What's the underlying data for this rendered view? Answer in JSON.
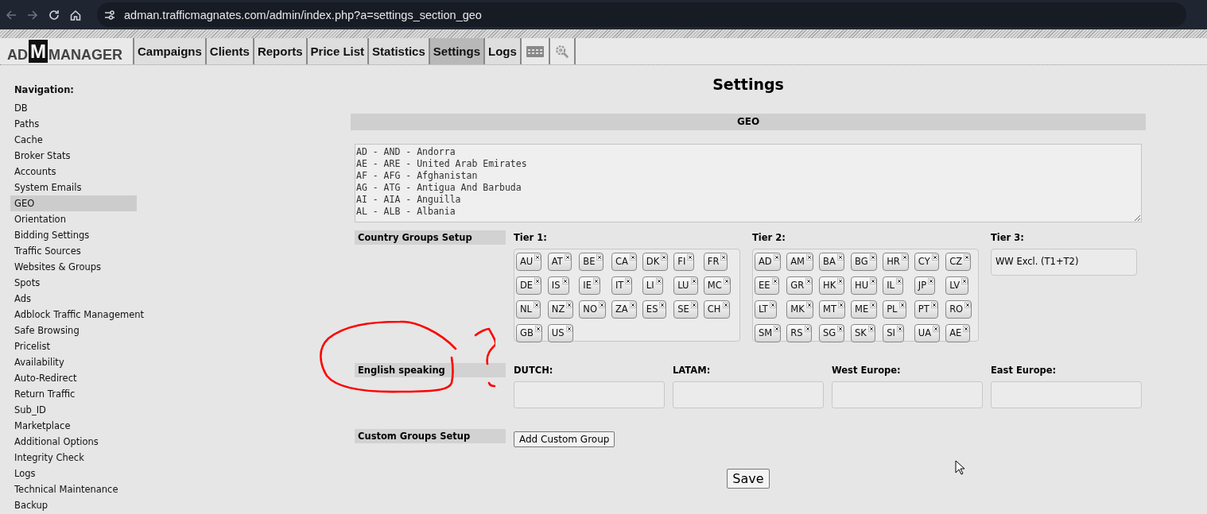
{
  "browser": {
    "url": "adman.trafficmagnates.com/admin/index.php?a=settings_section_geo"
  },
  "logo": {
    "left": "AD",
    "mark": "M",
    "right": "MANAGER"
  },
  "tabs": [
    {
      "label": "Campaigns",
      "selected": false
    },
    {
      "label": "Clients",
      "selected": false
    },
    {
      "label": "Reports",
      "selected": false
    },
    {
      "label": "Price List",
      "selected": false
    },
    {
      "label": "Statistics",
      "selected": false
    },
    {
      "label": "Settings",
      "selected": true
    },
    {
      "label": "Logs",
      "selected": false
    }
  ],
  "sidebar": {
    "heading": "Navigation:",
    "items": [
      {
        "label": "DB",
        "selected": false
      },
      {
        "label": "Paths",
        "selected": false
      },
      {
        "label": "Cache",
        "selected": false
      },
      {
        "label": "Broker Stats",
        "selected": false
      },
      {
        "label": "Accounts",
        "selected": false
      },
      {
        "label": "System Emails",
        "selected": false
      },
      {
        "label": "GEO",
        "selected": true
      },
      {
        "label": "Orientation",
        "selected": false
      },
      {
        "label": "Bidding Settings",
        "selected": false
      },
      {
        "label": "Traffic Sources",
        "selected": false
      },
      {
        "label": "Websites & Groups",
        "selected": false
      },
      {
        "label": "Spots",
        "selected": false
      },
      {
        "label": "Ads",
        "selected": false
      },
      {
        "label": "Adblock Traffic Management",
        "selected": false
      },
      {
        "label": "Safe Browsing",
        "selected": false
      },
      {
        "label": "Pricelist",
        "selected": false
      },
      {
        "label": "Availability",
        "selected": false
      },
      {
        "label": "Auto-Redirect",
        "selected": false
      },
      {
        "label": "Return Traffic",
        "selected": false
      },
      {
        "label": "Sub_ID",
        "selected": false
      },
      {
        "label": "Marketplace",
        "selected": false
      },
      {
        "label": "Additional Options",
        "selected": false
      },
      {
        "label": "Integrity Check",
        "selected": false
      },
      {
        "label": "Logs",
        "selected": false
      },
      {
        "label": "Technical Maintenance",
        "selected": false
      },
      {
        "label": "Backup",
        "selected": false
      }
    ]
  },
  "main": {
    "title": "Settings",
    "section_title": "GEO",
    "country_list": [
      "AD - AND - Andorra",
      "AE - ARE - United Arab Emirates",
      "AF - AFG - Afghanistan",
      "AG - ATG - Antigua And Barbuda",
      "AI - AIA - Anguilla",
      "AL - ALB - Albania"
    ],
    "rows": [
      {
        "label": "Country Groups Setup",
        "groups": [
          {
            "title": "Tier 1:",
            "kind": "chips",
            "chips": [
              "AU",
              "AT",
              "BE",
              "CA",
              "DK",
              "FI",
              "FR",
              "DE",
              "IS",
              "IE",
              "IT",
              "LI",
              "LU",
              "MC",
              "NL",
              "NZ",
              "NO",
              "ZA",
              "ES",
              "SE",
              "CH",
              "GB",
              "US"
            ]
          },
          {
            "title": "Tier 2:",
            "kind": "chips",
            "chips": [
              "AD",
              "AM",
              "BA",
              "BG",
              "HR",
              "CY",
              "CZ",
              "EE",
              "GR",
              "HK",
              "HU",
              "IL",
              "JP",
              "LV",
              "LT",
              "MK",
              "MT",
              "ME",
              "PL",
              "PT",
              "RO",
              "SM",
              "RS",
              "SG",
              "SK",
              "SI",
              "UA",
              "AE"
            ]
          },
          {
            "title": "Tier 3:",
            "kind": "text",
            "text": "WW Excl. (T1+T2)"
          }
        ]
      },
      {
        "label": "English speaking",
        "groups": [
          {
            "title": "DUTCH:",
            "kind": "field"
          },
          {
            "title": "LATAM:",
            "kind": "field"
          },
          {
            "title": "West Europe:",
            "kind": "field"
          },
          {
            "title": "East Europe:",
            "kind": "field"
          }
        ]
      }
    ],
    "custom_groups": {
      "label": "Custom Groups Setup",
      "button": "Add Custom Group"
    },
    "save_button": "Save"
  }
}
